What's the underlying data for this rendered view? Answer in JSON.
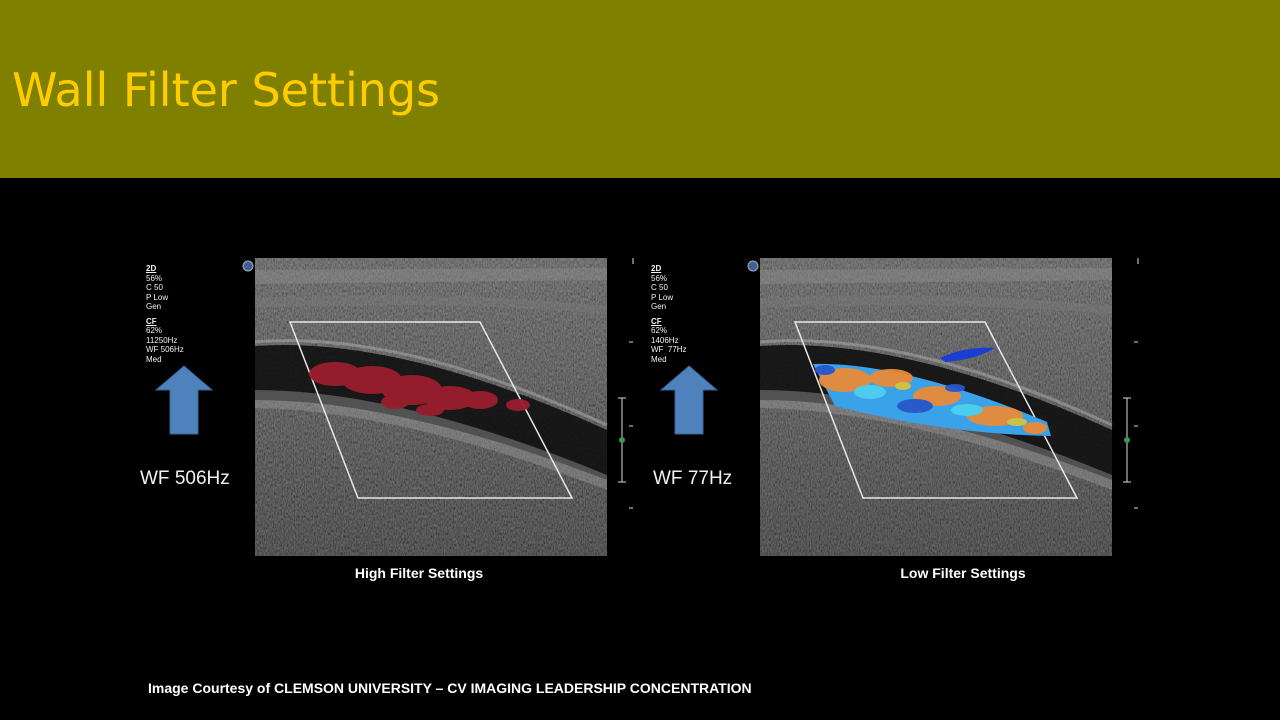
{
  "slide": {
    "title": "Wall Filter Settings"
  },
  "colors": {
    "header_bg": "#808000",
    "title": "#FFCC00",
    "background": "#000000",
    "arrow": "#4F81BD"
  },
  "panels": [
    {
      "readout": {
        "mode_2d": "2D",
        "pct_2d": "56%",
        "c": "C 50",
        "p": "P Low",
        "gen": "Gen",
        "mode_cf": "CF",
        "pct_cf": "62%",
        "freq": "11250Hz",
        "wf": "WF 506Hz",
        "med": "Med"
      },
      "arrow_icon": "up-arrow",
      "wf_label": "WF 506Hz",
      "caption": "High Filter Settings",
      "doppler_color": "red (single hue)"
    },
    {
      "readout": {
        "mode_2d": "2D",
        "pct_2d": "56%",
        "c": "C 50",
        "p": "P Low",
        "gen": "Gen",
        "mode_cf": "CF",
        "pct_cf": "62%",
        "freq": "1406Hz",
        "wf": "WF  77Hz",
        "med": "Med"
      },
      "arrow_icon": "up-arrow",
      "wf_label": "WF 77Hz",
      "caption": "Low Filter Settings",
      "doppler_color": "blue/orange mosaic"
    }
  ],
  "credit": "Image Courtesy of CLEMSON UNIVERSITY – CV IMAGING LEADERSHIP CONCENTRATION"
}
